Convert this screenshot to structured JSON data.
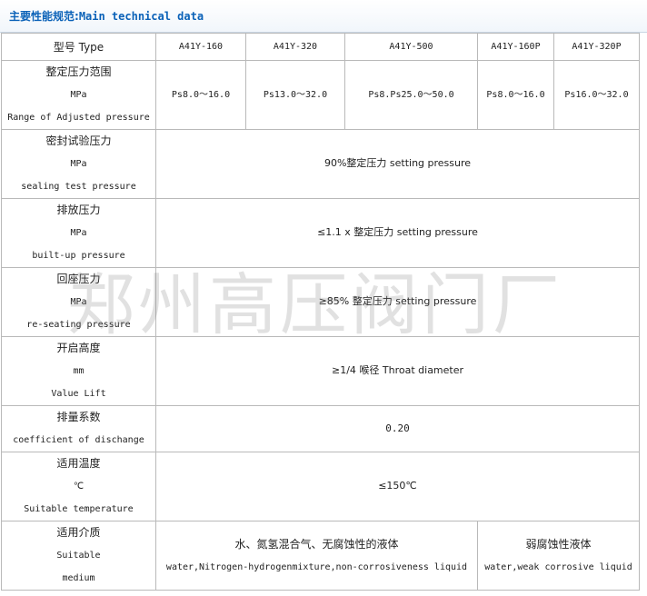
{
  "title": {
    "cn": "主要性能规范:",
    "en": "Main technical data"
  },
  "header": {
    "label": "型号 Type",
    "models": [
      "A41Y-160",
      "A41Y-320",
      "A41Y-500",
      "A41Y-160P",
      "A41Y-320P"
    ]
  },
  "rows": {
    "pressure_range": {
      "label_cn": "整定压力范围",
      "unit": "MPa",
      "label_en": "Range of Adjusted pressure",
      "values": [
        "Ps8.0～16.0",
        "Ps13.0～32.0",
        "Ps8.Ps25.0～50.0",
        "Ps8.0～16.0",
        "Ps16.0～32.0"
      ]
    },
    "sealing": {
      "label_cn": "密封试验压力",
      "unit": "MPa",
      "label_en": "sealing test pressure",
      "value": "90%整定压力 setting pressure"
    },
    "builtup": {
      "label_cn": "排放压力",
      "unit": "MPa",
      "label_en": "built-up pressure",
      "value": "≤1.1 x 整定压力 setting pressure"
    },
    "reseating": {
      "label_cn": "回座压力",
      "unit": "MPa",
      "label_en": "re-seating pressure",
      "value": "≥85% 整定压力 setting pressure"
    },
    "lift": {
      "label_cn": "开启高度",
      "unit": "mm",
      "label_en": "Value Lift",
      "value": "≥1/4 喉径 Throat diameter"
    },
    "discharge": {
      "label_cn": "排量系数",
      "label_en": "coefficient of dischange",
      "value": "0.20"
    },
    "temperature": {
      "label_cn": "适用温度",
      "unit": "℃",
      "label_en": "Suitable temperature",
      "value": "≤150℃"
    },
    "medium": {
      "label_cn": "适用介质",
      "label_en_1": "Suitable",
      "label_en_2": "medium",
      "value_a_cn": "水、氮氢混合气、无腐蚀性的液体",
      "value_a_en": "water,Nitrogen-hydrogenmixture,non-corrosiveness liquid",
      "value_b_cn": "弱腐蚀性液体",
      "value_b_en": "water,weak corrosive liquid"
    }
  },
  "watermark": "郑州高压阀门厂",
  "colors": {
    "title_text": "#0b62b8",
    "border": "#b9b9b9",
    "text": "#222222"
  }
}
